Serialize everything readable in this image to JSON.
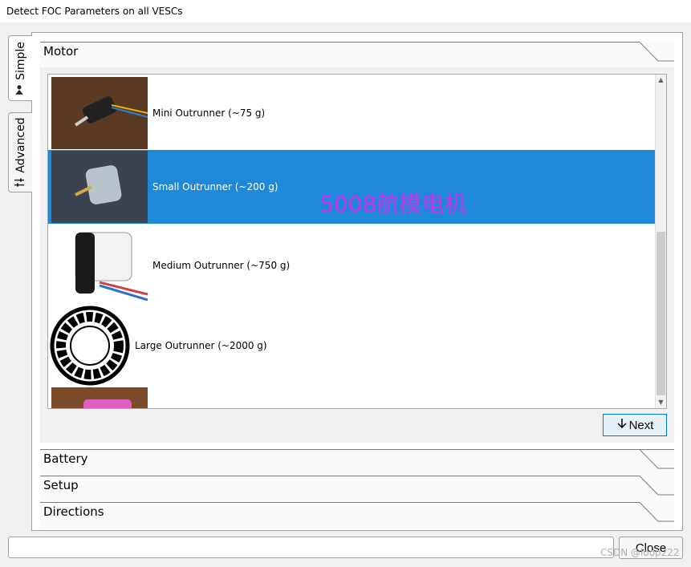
{
  "window": {
    "title": "Detect FOC Parameters on all VESCs"
  },
  "side_tabs": [
    {
      "label": "Simple",
      "icon": "person-icon"
    },
    {
      "label": "Advanced",
      "icon": "sliders-icon"
    }
  ],
  "sections": {
    "motor": "Motor",
    "battery": "Battery",
    "setup": "Setup",
    "directions": "Directions"
  },
  "motor_list": {
    "items": [
      {
        "label": "Mini Outrunner (~75 g)",
        "selected": false
      },
      {
        "label": "Small Outrunner (~200 g)",
        "selected": true
      },
      {
        "label": "Medium Outrunner (~750 g)",
        "selected": false
      },
      {
        "label": "Large Outrunner (~2000 g)",
        "selected": false
      }
    ],
    "annotation": "5008航模电机"
  },
  "buttons": {
    "next": "Next",
    "close": "Close"
  },
  "watermark": "CSDN @loop222",
  "colors": {
    "selection": "#1e88d9",
    "annotation": "#cc33ee",
    "accent_border": "#0078d7"
  }
}
